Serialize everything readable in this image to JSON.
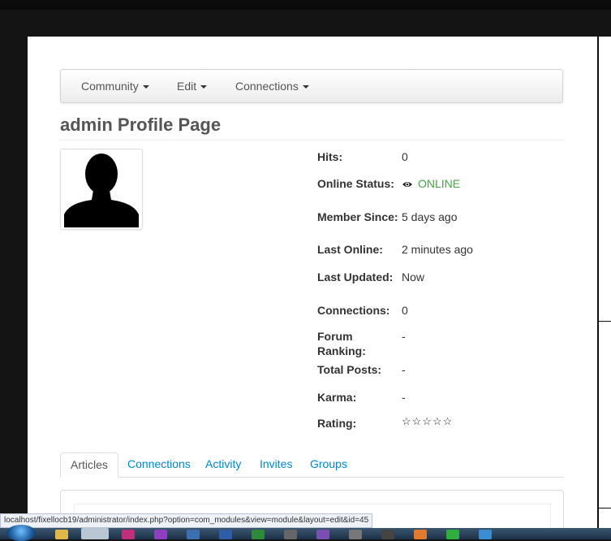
{
  "navbar": {
    "items": [
      "Community",
      "Edit",
      "Connections"
    ]
  },
  "page_title": "admin Profile Page",
  "avatar": {
    "icon": "default-user-silhouette-icon"
  },
  "details": [
    {
      "label": "Hits:",
      "value": "0"
    },
    {
      "label": "Online Status:",
      "value": "ONLINE",
      "icon": "eye-icon",
      "color": "#46a546"
    },
    {
      "label": "Member Since:",
      "value": "5 days ago"
    },
    {
      "label": "Last Online:",
      "value": "2 minutes ago"
    },
    {
      "label": "Last Updated:",
      "value": "Now"
    },
    {
      "label": "Connections:",
      "value": "0"
    },
    {
      "label": "Forum Ranking:",
      "value": "-"
    },
    {
      "label": "Total Posts:",
      "value": "-"
    },
    {
      "label": "Karma:",
      "value": "-"
    },
    {
      "label": "Rating:",
      "value": "☆☆☆☆☆",
      "rating": 0,
      "max_rating": 5
    }
  ],
  "tabs": {
    "items": [
      "Articles",
      "Connections",
      "Activity",
      "Invites",
      "Groups"
    ],
    "active": "Articles"
  },
  "statusbar": {
    "url": "localhost/fixellocb19/administrator/index.php?option=com_modules&view=module&layout=edit&id=45"
  },
  "colors": {
    "link": "#0088cc",
    "online": "#46a546",
    "title": "#555555"
  },
  "taskbar": {
    "icons": [
      "start-orb-icon",
      "folder-icon",
      "firefox-icon",
      "app-icon",
      "app-icon",
      "app-icon",
      "app-icon",
      "app-icon",
      "app-icon",
      "app-icon",
      "app-icon",
      "app-icon",
      "app-icon",
      "app-icon",
      "app-icon"
    ]
  }
}
